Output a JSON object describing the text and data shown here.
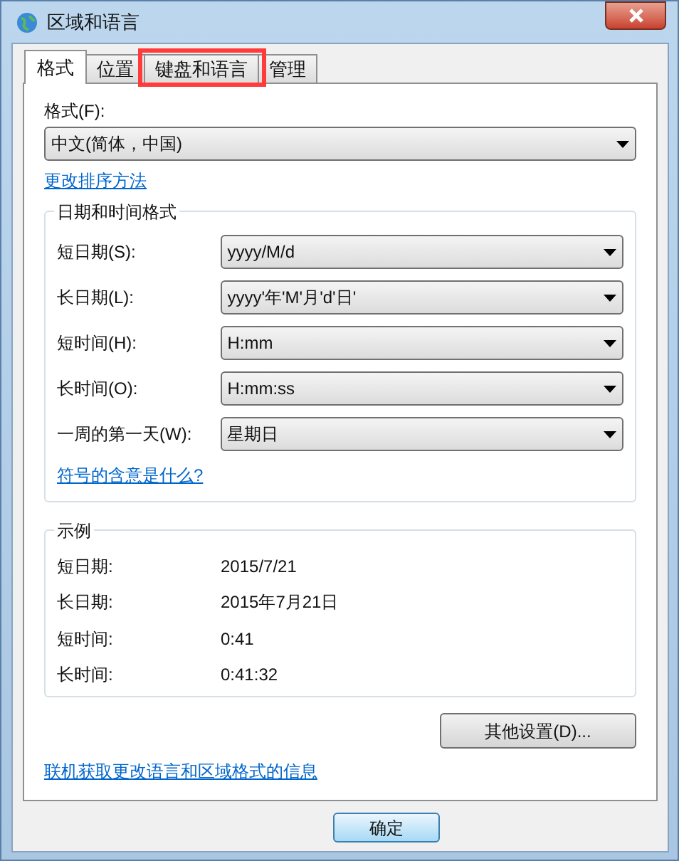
{
  "window": {
    "title": "区域和语言"
  },
  "tabs": [
    {
      "label": "格式",
      "selected": true,
      "highlighted": false
    },
    {
      "label": "位置",
      "selected": false,
      "highlighted": false
    },
    {
      "label": "键盘和语言",
      "selected": false,
      "highlighted": true
    },
    {
      "label": "管理",
      "selected": false,
      "highlighted": false
    }
  ],
  "format": {
    "label": "格式(F):",
    "value": "中文(简体，中国)",
    "link": "更改排序方法"
  },
  "date_time_group": {
    "title": "日期和时间格式",
    "rows": [
      {
        "label": "短日期(S):",
        "value": "yyyy/M/d"
      },
      {
        "label": "长日期(L):",
        "value": "yyyy'年'M'月'd'日'"
      },
      {
        "label": "短时间(H):",
        "value": "H:mm"
      },
      {
        "label": "长时间(O):",
        "value": "H:mm:ss"
      },
      {
        "label": "一周的第一天(W):",
        "value": "星期日"
      }
    ],
    "link": "符号的含意是什么?"
  },
  "examples_group": {
    "title": "示例",
    "rows": [
      {
        "label": "短日期:",
        "value": "2015/7/21"
      },
      {
        "label": "长日期:",
        "value": "2015年7月21日"
      },
      {
        "label": "短时间:",
        "value": "0:41"
      },
      {
        "label": "长时间:",
        "value": "0:41:32"
      }
    ]
  },
  "more_button": "其他设置(D)...",
  "online_link": "联机获取更改语言和区域格式的信息",
  "buttons": [
    {
      "label": "确定",
      "default": true
    }
  ]
}
